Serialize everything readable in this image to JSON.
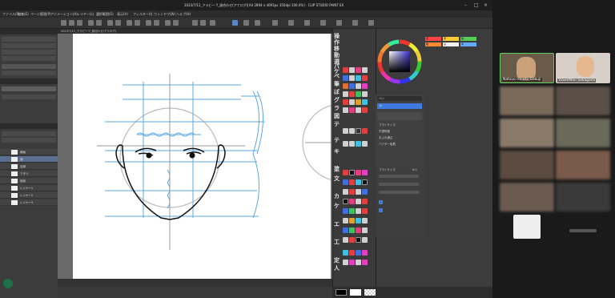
{
  "titlebar": {
    "title": "2023/7/12_クラビー Y_顔合わせ(アナログ)[A4 2894 x 4093px 350dpi 100.0%] - CLIP STUDIO PAINT EX"
  },
  "menubar": {
    "items": [
      "ファイル(F)",
      "編集(E)",
      "ページ管理(P)",
      "アニメーション(A)",
      "レイヤー(L)",
      "選択範囲(S)",
      "表示(V)",
      "フィルター(I)",
      "ウィンドウ(W)",
      "ヘルプ(H)"
    ]
  },
  "canvas": {
    "tab_label": "2023/7/12_クラビー Y_顔合わせ(アナログ)"
  },
  "tools": {
    "labels": [
      "操",
      "作",
      "移",
      "動",
      "選",
      "択",
      "パ",
      "ケ",
      "ツ",
      "ペ",
      "ン",
      "筆",
      "鉛",
      "水",
      "彩",
      "ぼ",
      "か",
      "し",
      "グ",
      "ラ",
      "デ",
      "図",
      "形",
      "テ",
      "キ",
      "ス",
      "ト",
      "塗",
      "文",
      "字",
      "カ",
      "ケ",
      "ア",
      "ミ",
      "エ",
      "工",
      "具",
      "定",
      "規",
      "人",
      "体"
    ]
  },
  "right_panel": {
    "swatch_labels": [
      "白",
      "黒",
      "グレー",
      "赤",
      "橙",
      "黄",
      "緑",
      "青",
      "紫"
    ],
    "swatch_colors": [
      "#ff4444",
      "#ffcc33",
      "#55cc55",
      "#ff8833",
      "#f0f0f0",
      "#66aaff"
    ],
    "prop_title": "ペン",
    "prop_row1": "G",
    "prop_row2": "Gペン",
    "prop_fields": [
      "ブラシサイズ",
      "不透明度",
      "手ぶれ補正",
      "ベクター吸着"
    ],
    "subtool_label": "ブラシサイズ",
    "subtool_value": "6.0"
  },
  "meeting": {
    "participants": [
      {
        "name": "Natsuo Hinata Gakuji"
      },
      {
        "name": "YaSenMan Sakagami"
      }
    ]
  },
  "left_panel": {
    "layer_names": [
      "線画",
      "顔",
      "目線",
      "アタリ",
      "用紙",
      "レイヤー1",
      "レイヤー2",
      "レイヤー3"
    ]
  }
}
